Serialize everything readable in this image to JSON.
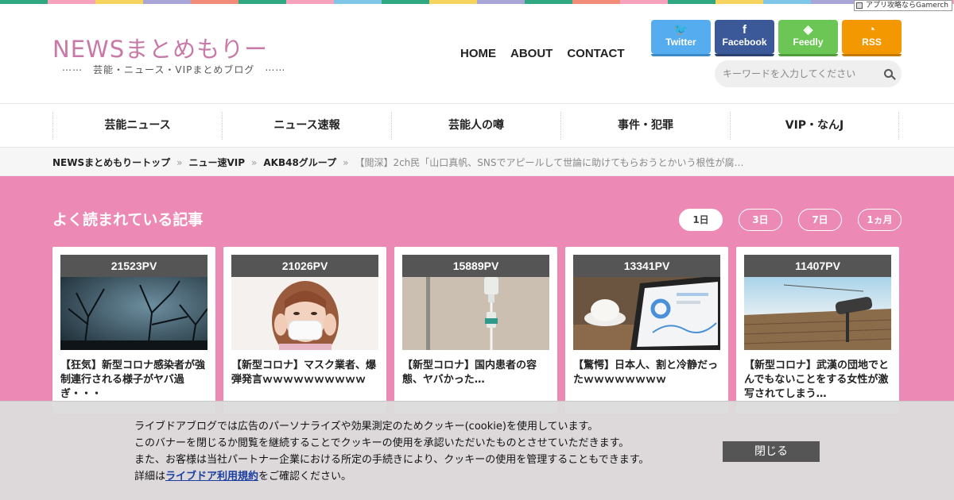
{
  "colors": {
    "stripe": [
      "#2fa882",
      "#f6a3bb",
      "#f7d45e",
      "#a8a6d6",
      "#f28c78",
      "#2fa882",
      "#f6a3bb",
      "#7fc7e8",
      "#2fa882",
      "#f7d45e",
      "#a8a6d6",
      "#2fa882",
      "#f28c78",
      "#f6a3bb",
      "#2fa882",
      "#f7d45e",
      "#7fc7e8",
      "#a8a6d6",
      "#2fa882",
      "#f6a3bb"
    ],
    "popular_bg": "#ec8ab5",
    "logo": "#c879a8"
  },
  "gamerch_badge": "アプリ攻略ならGamerch",
  "site": {
    "logo": "NEWSまとめもりー",
    "tagline": "⋯⋯　芸能・ニュース・VIPまとめブログ　⋯⋯"
  },
  "global_nav": [
    "HOME",
    "ABOUT",
    "CONTACT"
  ],
  "social": [
    {
      "label": "Twitter",
      "icon": "bird-icon",
      "glyph": "🐦",
      "color": "#55acee",
      "shade": "#3a8ac8"
    },
    {
      "label": "Facebook",
      "icon": "facebook-icon",
      "glyph": "f",
      "color": "#3b5998",
      "shade": "#2b4170"
    },
    {
      "label": "Feedly",
      "icon": "feedly-icon",
      "glyph": "◈",
      "color": "#6cc655",
      "shade": "#4e9c3b"
    },
    {
      "label": "RSS",
      "icon": "rss-icon",
      "glyph": "◔",
      "color": "#f39800",
      "shade": "#c47a00"
    }
  ],
  "search": {
    "placeholder": "キーワードを入力してください",
    "icon": "search-icon"
  },
  "categories": [
    "芸能ニュース",
    "ニュース速報",
    "芸能人の噂",
    "事件・犯罪",
    "VIP・なんJ"
  ],
  "breadcrumb": {
    "items": [
      "NEWSまとめもりートップ",
      "ニュー速VIP",
      "AKB48グループ"
    ],
    "current": "【閲深】2ch民「山口真帆、SNSでアピールして世論に助けてもらおうとかいう根性が腐…",
    "separator": "»"
  },
  "popular": {
    "title": "よく読まれている記事",
    "tabs": [
      "1日",
      "3日",
      "7日",
      "1ヵ月"
    ],
    "active_tab": "1日",
    "articles": [
      {
        "pv": "21523PV",
        "title": "【狂気】新型コロナ感染者が強制連行される様子がヤバ過ぎ・・・"
      },
      {
        "pv": "21026PV",
        "title": "【新型コロナ】マスク業者、爆弾発言ｗｗｗｗｗｗｗｗｗｗ"
      },
      {
        "pv": "15889PV",
        "title": "【新型コロナ】国内患者の容態、ヤバかった…"
      },
      {
        "pv": "13341PV",
        "title": "【驚愕】日本人、割と冷静だったｗｗｗｗｗｗｗｗ"
      },
      {
        "pv": "11407PV",
        "title": "【新型コロナ】武漢の団地でとんでもないことをする女性が激写されてしまう…"
      }
    ]
  },
  "cookie": {
    "line1": "ライブドアブログでは広告のパーソナライズや効果測定のためクッキー(cookie)を使用しています。",
    "line2": "このバナーを閉じるか閲覧を継続することでクッキーの使用を承認いただいたものとさせていただきます。",
    "line3": "また、お客様は当社パートナー企業における所定の手続きにより、クッキーの使用を管理することもできます。",
    "line4_pre": "詳細は",
    "line4_link": "ライブドア利用規約",
    "line4_post": "をご確認ください。",
    "close": "閉じる"
  }
}
